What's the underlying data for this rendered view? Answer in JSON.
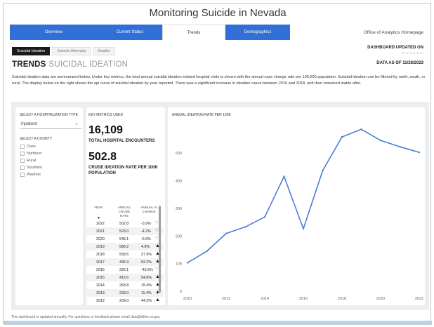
{
  "title": "Monitoring Suicide in Nevada",
  "tabs": [
    {
      "label": "Overview",
      "active": false
    },
    {
      "label": "Current Status",
      "active": false
    },
    {
      "label": "Trends",
      "active": true
    },
    {
      "label": "Demographics",
      "active": false
    }
  ],
  "homepage_link": "Office of Analytics Homepage",
  "subtabs": [
    {
      "label": "Suicidal Ideation",
      "active": true
    },
    {
      "label": "Suicide Attempts",
      "active": false
    },
    {
      "label": "Deaths",
      "active": false
    }
  ],
  "dashboard_updated_label": "DASHBOARD UPDATED ON",
  "data_as_of": "DATA AS OF 11/28/2023",
  "heading": {
    "main": "TRENDS",
    "sub": "SUICIDAL IDEATION"
  },
  "description": "Suicidal ideation data are summarized below. Under key metrics, the total annual suicidal ideation-related hospital visits is shown with the annual case change rate per 100,000 population. Suicidal ideation can be filtered by north, south, or rural. The display below on the right shows the epi curve of suicidal ideation by year reported. There was a significant increase in ideation cases between 2016 and 2018, and then remained stable after.",
  "filters": {
    "hosp_type_label": "SELECT A HOSPITALIZATION TYPE",
    "hosp_type_value": "Inpatient",
    "county_label": "SELECT A COUNTY",
    "counties": [
      "Clark",
      "Northern",
      "Rural",
      "Southern",
      "Washoe"
    ]
  },
  "metrics": {
    "label": "KEY METRICS USED",
    "total_value": "16,109",
    "total_label": "TOTAL HOSPITAL ENCOUNTERS",
    "rate_value": "502.8",
    "rate_label": "CRUDE IDEATION RATE PER 100K POPULATION"
  },
  "table": {
    "headers": [
      "YEAR",
      "ANNUAL CRUDE RATE",
      "ANNUAL % CHANGE"
    ],
    "rows": [
      {
        "year": "2022",
        "rate": "502.8",
        "change": "-3.9%",
        "dir": "down"
      },
      {
        "year": "2021",
        "rate": "523.0",
        "change": "-4.2%",
        "dir": "down"
      },
      {
        "year": "2020",
        "rate": "546.1",
        "change": "-6.9%",
        "dir": "down"
      },
      {
        "year": "2019",
        "rate": "586.2",
        "change": "4.9%",
        "dir": "up"
      },
      {
        "year": "2018",
        "rate": "558.6",
        "change": "27.9%",
        "dir": "up"
      },
      {
        "year": "2017",
        "rate": "436.9",
        "change": "93.2%",
        "dir": "up"
      },
      {
        "year": "2016",
        "rate": "226.1",
        "change": "-45.6%",
        "dir": "down"
      },
      {
        "year": "2015",
        "rate": "415.6",
        "change": "54.6%",
        "dir": "up"
      },
      {
        "year": "2014",
        "rate": "268.8",
        "change": "15.4%",
        "dir": "up"
      },
      {
        "year": "2013",
        "rate": "233.0",
        "change": "11.4%",
        "dir": "up"
      },
      {
        "year": "2012",
        "rate": "209.0",
        "change": "44.3%",
        "dir": "up"
      }
    ]
  },
  "chart_data": {
    "type": "line",
    "title": "ANNUAL IDEATION RATE PER 100K",
    "x": [
      2010,
      2011,
      2012,
      2013,
      2014,
      2015,
      2016,
      2017,
      2018,
      2019,
      2020,
      2021,
      2022
    ],
    "series": [
      {
        "values": [
          103,
          144.8,
          209.0,
          233.0,
          268.8,
          415.6,
          226.1,
          436.9,
          558.6,
          586.2,
          546.1,
          523.0,
          502.8
        ]
      }
    ],
    "x_ticks": [
      2010,
      2012,
      2014,
      2016,
      2018,
      2020,
      2022
    ],
    "y_ticks": [
      0,
      100,
      200,
      300,
      400,
      500
    ],
    "xlim": [
      2010,
      2022
    ],
    "ylim": [
      0,
      620
    ],
    "grid": false,
    "color": "#4a7fd4"
  },
  "footer": "This dashboard is updated annually. For questions or feedback please email data@dhhs.nv.gov."
}
